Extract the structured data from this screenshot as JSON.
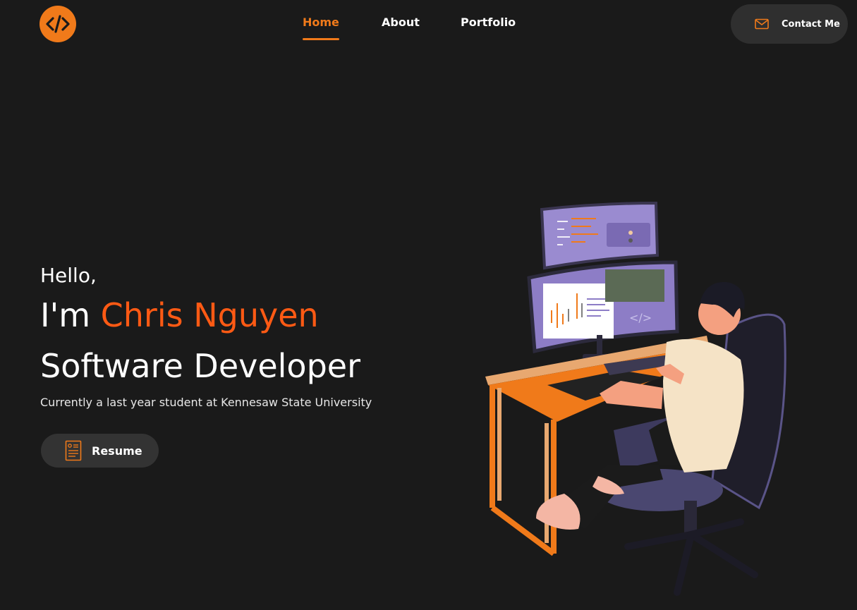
{
  "nav": {
    "logo_icon": "code-brackets-icon",
    "items": [
      {
        "label": "Home",
        "active": true
      },
      {
        "label": "About",
        "active": false
      },
      {
        "label": "Portfolio",
        "active": false
      }
    ],
    "contact": {
      "label": "Contact Me",
      "icon": "mail-icon"
    }
  },
  "hero": {
    "greeting": "Hello,",
    "intro_prefix": "I'm",
    "name": "Chris Nguyen",
    "role": "Software Developer",
    "subtitle": "Currently a last year student at Kennesaw State University",
    "resume": {
      "label": "Resume",
      "icon": "resume-document-icon"
    }
  },
  "illustration": {
    "subject": "developer-at-desk-illustration"
  },
  "colors": {
    "background": "#1a1a1a",
    "accent": "#f07a1a",
    "name_accent": "#ff5a14",
    "button_bg": "#333333"
  }
}
